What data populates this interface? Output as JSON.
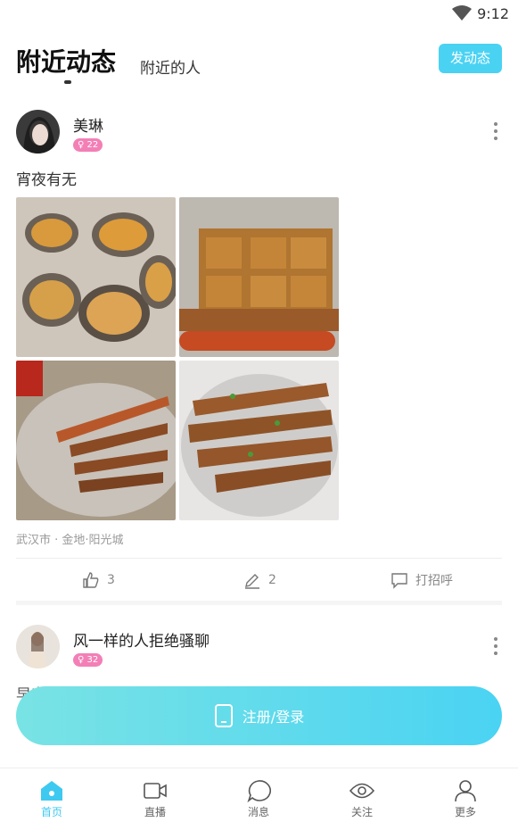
{
  "status_bar": {
    "time": "9:12"
  },
  "header": {
    "active_tab": "附近动态",
    "inactive_tab": "附近的人",
    "post_button": "发动态"
  },
  "posts": [
    {
      "username": "美琳",
      "age_badge": "22",
      "text": "宵夜有无",
      "location": "武汉市 · 金地·阳光城",
      "likes": "3",
      "comments": "2",
      "greet": "打招呼"
    },
    {
      "username": "风一样的人拒绝骚聊",
      "age_badge": "32",
      "text": "早安"
    }
  ],
  "login_button": "注册/登录",
  "tabbar": {
    "items": [
      {
        "label": "首页",
        "icon": "home-icon"
      },
      {
        "label": "直播",
        "icon": "video-camera-icon"
      },
      {
        "label": "消息",
        "icon": "chat-bubble-icon"
      },
      {
        "label": "关注",
        "icon": "eye-icon"
      },
      {
        "label": "更多",
        "icon": "person-icon"
      }
    ],
    "active_color": "#3ec9f0"
  },
  "colors": {
    "accent": "#4ad2f3",
    "badge": "#f37fb6"
  }
}
